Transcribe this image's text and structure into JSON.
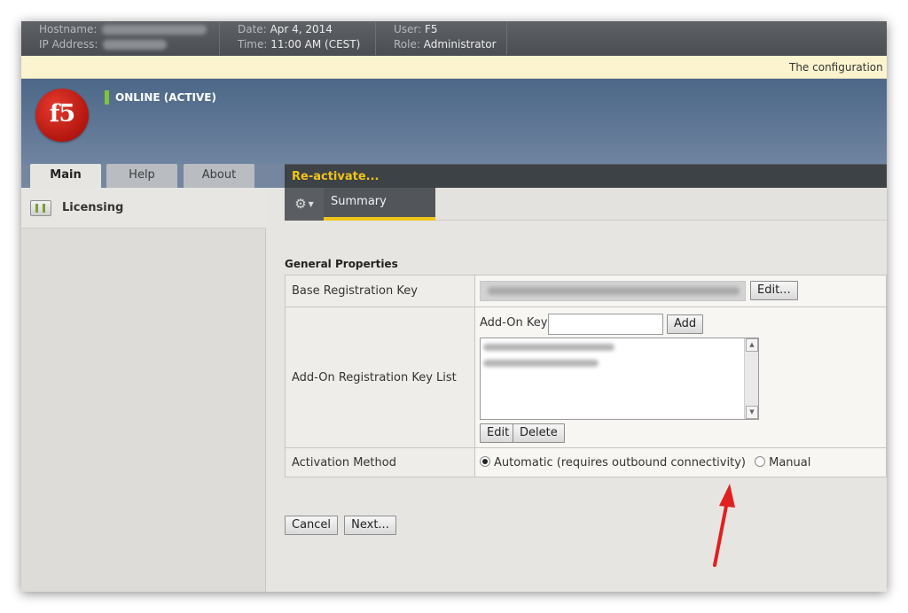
{
  "header": {
    "hostname_label": "Hostname:",
    "ip_label": "IP Address:",
    "date_label": "Date:",
    "date_value": "Apr 4, 2014",
    "time_label": "Time:",
    "time_value": "11:00 AM (CEST)",
    "user_label": "User:",
    "user_value": "F5",
    "role_label": "Role:",
    "role_value": "Administrator"
  },
  "notice": {
    "text": "The configuration h"
  },
  "banner": {
    "logo_text": "f5",
    "status": "ONLINE (ACTIVE)",
    "status_color": "#7fc33d"
  },
  "tabs": [
    {
      "label": "Main",
      "active": true
    },
    {
      "label": "Help",
      "active": false
    },
    {
      "label": "About",
      "active": false
    }
  ],
  "sidebar": {
    "items": [
      {
        "label": "Licensing",
        "icon": "license-icon"
      }
    ]
  },
  "content": {
    "title": "Re-activate...",
    "title_color": "#f0c419",
    "menu_icon": "gear-icon",
    "subtab": "Summary",
    "section_title": "General Properties",
    "rows": {
      "base_key_label": "Base Registration Key",
      "addon_list_label": "Add-On Registration Key List",
      "activation_label": "Activation Method"
    },
    "buttons": {
      "edit_key": "Edit...",
      "addon_key_label": "Add-On Key",
      "add": "Add",
      "edit": "Edit",
      "delete": "Delete",
      "cancel": "Cancel",
      "next": "Next..."
    },
    "addon_key_value": "",
    "activation": {
      "automatic_label": "Automatic (requires outbound connectivity)",
      "manual_label": "Manual",
      "selected": "automatic"
    }
  },
  "annotation": {
    "arrow_color": "#e02020"
  }
}
